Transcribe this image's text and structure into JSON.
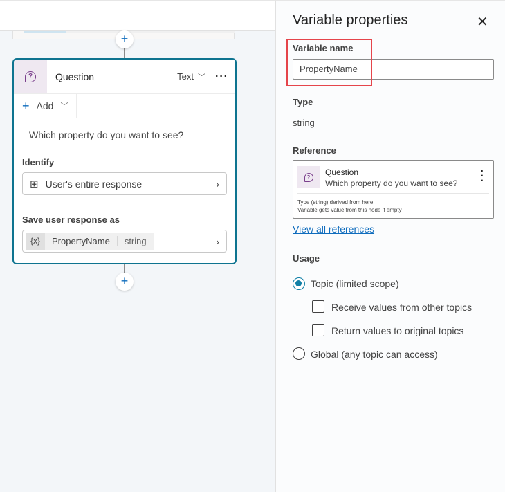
{
  "canvas": {
    "node": {
      "title": "Question",
      "type_label": "Text",
      "more_label": "···",
      "add_label": "Add",
      "question_text": "Which property do you want to see?",
      "identify_label": "Identify",
      "identify_value": "User's entire response",
      "save_label": "Save user response as",
      "variable_icon": "{x}",
      "variable_name": "PropertyName",
      "variable_type": "string"
    }
  },
  "panel": {
    "title": "Variable properties",
    "close_icon": "✕",
    "variable_name_label": "Variable name",
    "variable_name_value": "PropertyName",
    "type_label": "Type",
    "type_value": "string",
    "reference_label": "Reference",
    "reference": {
      "title": "Question",
      "subtitle": "Which property do you want to see?",
      "note_line1": "Type (string) derived from here",
      "note_line2": "Variable gets value from this node if empty"
    },
    "view_all_label": "View all references",
    "usage_label": "Usage",
    "usage_options": {
      "topic": {
        "label": "Topic (limited scope)",
        "selected": true
      },
      "receive": {
        "label": "Receive values from other topics",
        "checked": false
      },
      "return": {
        "label": "Return values to original topics",
        "checked": false
      },
      "global": {
        "label": "Global (any topic can access)",
        "selected": false
      }
    },
    "accent_color": "#0f7fa6",
    "highlight_color": "#e5454b"
  }
}
